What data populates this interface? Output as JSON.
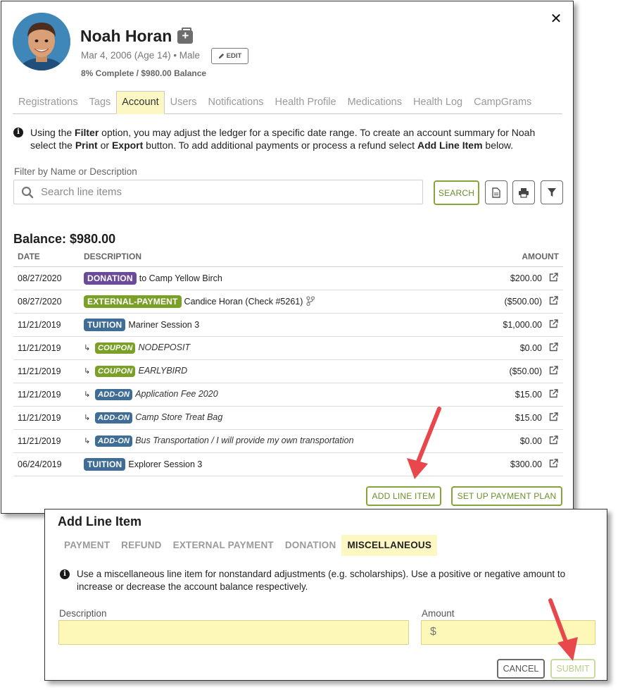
{
  "profile": {
    "name": "Noah Horan",
    "dob_text": "Mar 4, 2006 (Age 14) • Male",
    "edit_label": "EDIT",
    "summary": "8% Complete / $980.00 Balance"
  },
  "tabs": [
    {
      "label": "Registrations",
      "active": false
    },
    {
      "label": "Tags",
      "active": false
    },
    {
      "label": "Account",
      "active": true
    },
    {
      "label": "Users",
      "active": false
    },
    {
      "label": "Notifications",
      "active": false
    },
    {
      "label": "Health Profile",
      "active": false
    },
    {
      "label": "Medications",
      "active": false
    },
    {
      "label": "Health Log",
      "active": false
    },
    {
      "label": "CampGrams",
      "active": false
    }
  ],
  "info": {
    "p1": "Using the ",
    "b1": "Filter",
    "p2": " option, you may adjust the ledger for a specific date range. To create an account summary for Noah select the ",
    "b2": "Print",
    "p3": " or ",
    "b3": "Export",
    "p4": " button. To add additional payments or process a refund select ",
    "b4": "Add Line Item",
    "p5": " below."
  },
  "filter": {
    "label": "Filter by Name or Description",
    "placeholder": "Search line items",
    "search_button": "SEARCH"
  },
  "ledger": {
    "balance_title": "Balance: $980.00",
    "columns": {
      "date": "DATE",
      "description": "DESCRIPTION",
      "amount": "AMOUNT"
    },
    "rows": [
      {
        "date": "08/27/2020",
        "sub": false,
        "badge": "DONATION",
        "badge_color": "#6b4a9a",
        "text": "to Camp Yellow Birch",
        "italic": false,
        "amount": "$200.00",
        "negative": false,
        "branch": false
      },
      {
        "date": "08/27/2020",
        "sub": false,
        "badge": "EXTERNAL-PAYMENT",
        "badge_color": "#7aa028",
        "text": "Candice Horan (Check #5261)",
        "italic": false,
        "amount": "($500.00)",
        "negative": true,
        "branch": true
      },
      {
        "date": "11/21/2019",
        "sub": false,
        "badge": "TUITION",
        "badge_color": "#3f6d96",
        "text": "Mariner Session 3",
        "italic": false,
        "amount": "$1,000.00",
        "negative": false,
        "branch": false
      },
      {
        "date": "11/21/2019",
        "sub": true,
        "badge": "COUPON",
        "badge_color": "#7aa028",
        "text": "NODEPOSIT",
        "italic": true,
        "amount": "$0.00",
        "negative": false,
        "branch": false
      },
      {
        "date": "11/21/2019",
        "sub": true,
        "badge": "COUPON",
        "badge_color": "#7aa028",
        "text": "EARLYBIRD",
        "italic": true,
        "amount": "($50.00)",
        "negative": true,
        "branch": false
      },
      {
        "date": "11/21/2019",
        "sub": true,
        "badge": "ADD-ON",
        "badge_color": "#3f6d96",
        "text": "Application Fee 2020",
        "italic": true,
        "amount": "$15.00",
        "negative": false,
        "branch": false
      },
      {
        "date": "11/21/2019",
        "sub": true,
        "badge": "ADD-ON",
        "badge_color": "#3f6d96",
        "text": "Camp Store Treat Bag",
        "italic": true,
        "amount": "$15.00",
        "negative": false,
        "branch": false
      },
      {
        "date": "11/21/2019",
        "sub": true,
        "badge": "ADD-ON",
        "badge_color": "#3f6d96",
        "text": "Bus Transportation / I will provide my own transportation",
        "italic": true,
        "amount": "$0.00",
        "negative": false,
        "branch": false
      },
      {
        "date": "06/24/2019",
        "sub": false,
        "badge": "TUITION",
        "badge_color": "#3f6d96",
        "text": "Explorer Session 3",
        "italic": false,
        "amount": "$300.00",
        "negative": false,
        "branch": false
      }
    ],
    "add_line_item": "ADD LINE ITEM",
    "payment_plan": "SET UP PAYMENT PLAN"
  },
  "add_panel": {
    "title": "Add Line Item",
    "tabs": [
      {
        "label": "PAYMENT",
        "active": false
      },
      {
        "label": "REFUND",
        "active": false
      },
      {
        "label": "EXTERNAL PAYMENT",
        "active": false
      },
      {
        "label": "DONATION",
        "active": false
      },
      {
        "label": "MISCELLANEOUS",
        "active": true
      }
    ],
    "info": "Use a miscellaneous line item for nonstandard adjustments (e.g. scholarships). Use a positive or negative amount to increase or decrease the account balance respectively.",
    "description_label": "Description",
    "amount_label": "Amount",
    "currency_symbol": "$",
    "cancel": "CANCEL",
    "submit": "SUBMIT"
  },
  "colors": {
    "accent_green": "#84a53a",
    "tab_highlight": "#fdf8c3",
    "negative_red": "#d04848",
    "arrow_red": "#e8474c"
  }
}
